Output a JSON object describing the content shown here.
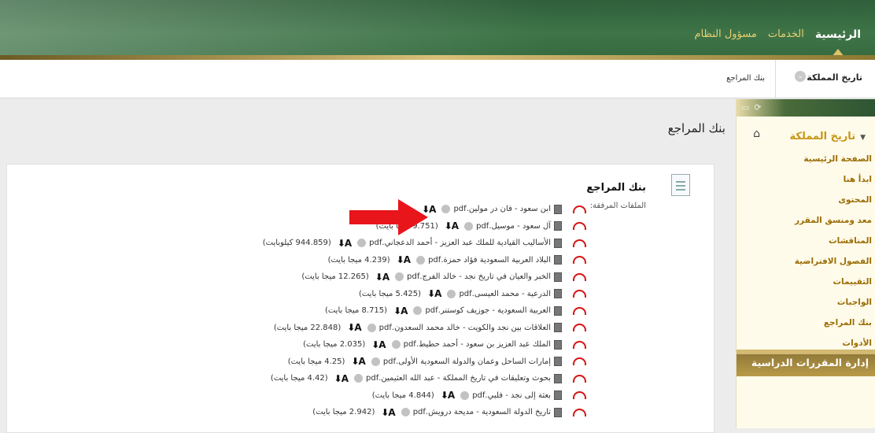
{
  "header": {
    "nav_tabs": [
      {
        "label": "الرئيسية",
        "active": true
      },
      {
        "label": "الخدمات",
        "active": false
      },
      {
        "label": "مسؤول النظام",
        "active": false
      }
    ]
  },
  "breadcrumb": {
    "course": "تاريخ المملكة",
    "page": "بنك المراجع"
  },
  "sidebar": {
    "title": "تاريخ المملكة",
    "items": [
      "الصفحة الرئيسية",
      "ابدأ هنا",
      "المحتوى",
      "معد ومنسق المقرر",
      "المناقشات",
      "الفصول الافتراضية",
      "التقييمات",
      "الواجبات",
      "بنك المراجع",
      "الأدوات"
    ],
    "footer": "إدارة المقررات الدراسية"
  },
  "main": {
    "page_title": "بنك المراجع",
    "item_title": "بنك المراجع",
    "attachments_label": "الملفات المرفقة:",
    "files": [
      {
        "name": "ابن سعود - فان در مولين.pdf",
        "size": ""
      },
      {
        "name": "آل سعود - موسيل.pdf",
        "size": "(9.751 ميجا بايت)"
      },
      {
        "name": "الأساليب القيادية للملك عبد العزيز - أحمد الدعجاني.pdf",
        "size": "(944.859 كيلوبايت)"
      },
      {
        "name": "البلاد العربية السعودية فؤاد حمزة.pdf",
        "size": "(4.239 ميجا بايت)"
      },
      {
        "name": "الخبر والعيان في تاريخ نجد - خالد الفرج.pdf",
        "size": "(12.265 ميجا بايت)"
      },
      {
        "name": "الدرعية - محمد العيسى.pdf",
        "size": "(5.425 ميجا بايت)"
      },
      {
        "name": "العربية السعودية - جوزيف كوستنر.pdf",
        "size": "(8.715 ميجا بايت)"
      },
      {
        "name": "العلاقات بين نجد والكويت - خالد محمد السعدون.pdf",
        "size": "(22.848 ميجا بايت)"
      },
      {
        "name": "الملك عبد العزيز بن سعود - أحمد حطيط.pdf",
        "size": "(2.035 ميجا بايت)"
      },
      {
        "name": "إمارات الساحل وعمان والدولة السعودية الأولى.pdf",
        "size": "(4.25 ميجا بايت)"
      },
      {
        "name": "بحوث وتعليقات في تاريخ المملكة - عبد الله العثيمين.pdf",
        "size": "(4.42 ميجا بايت)"
      },
      {
        "name": "بعثة إلى نجد - فلبي.pdf",
        "size": "(4.844 ميجا بايت)"
      },
      {
        "name": "تاريخ الدولة السعودية - مديحة درويش.pdf",
        "size": "(2.942 ميجا بايت)"
      }
    ]
  },
  "colors": {
    "header_green": "#3e7447",
    "accent_gold": "#c79516",
    "annotation_arrow": "#e8151b"
  }
}
